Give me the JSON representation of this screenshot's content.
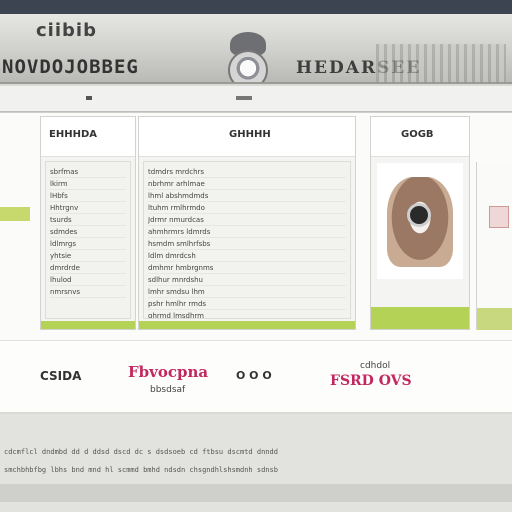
{
  "header": {
    "brand": "ciibib",
    "title": "NOVDOJOBBEG",
    "title_right": "HEDARSEE"
  },
  "columns": {
    "left": {
      "heading": "EHHHDA",
      "items": [
        "sbrfmas",
        "lkirm",
        "lHbfs",
        "Hhtrgnv",
        "tsurds",
        "sdmdes",
        "ldlmrgs",
        "yhtsie",
        "dmrdrde",
        "lhulod",
        "nmrsnvs"
      ]
    },
    "center": {
      "heading": "GHHHH",
      "items": [
        "tdmdrs mrdchrs",
        "nbrhmr arhlmae",
        "lhml abshmdmds",
        "ltuhm rmlhrmdo",
        "Jdrmr nmurdcas",
        "ahmhrmrs ldmrds",
        "hsmdm smlhrfsbs",
        "ldlm dmrdcsh",
        "dmhmr hmbrgnms",
        "sdlhur mnrdshu",
        "lmhr smdsu lhm",
        "pshr hmlhr rmds",
        "ghrmd lmsdhrm"
      ]
    },
    "right": {
      "heading": "GOGB"
    }
  },
  "info": {
    "label_left": "CSIDA",
    "pink_value": "Fbvocpna",
    "sub_value": "bbsdsaf",
    "icons_text": "O O O",
    "right_top": "cdhdol",
    "right_value": "FSRD OVS"
  },
  "footer": {
    "rows": [
      "cdcmflcl dndmbd dd d ddsd dscd dc s  dsdsoeb cd ftbsu dscmtd dnndd",
      "smchbhbfbg lbhs bnd mnd hl scmmd bmhd ndsdn chsgndhlshsmdnh sdnsb"
    ]
  },
  "colors": {
    "accent_green": "#b3d256",
    "accent_pink": "#c2285f",
    "topbar": "#3c4452"
  }
}
